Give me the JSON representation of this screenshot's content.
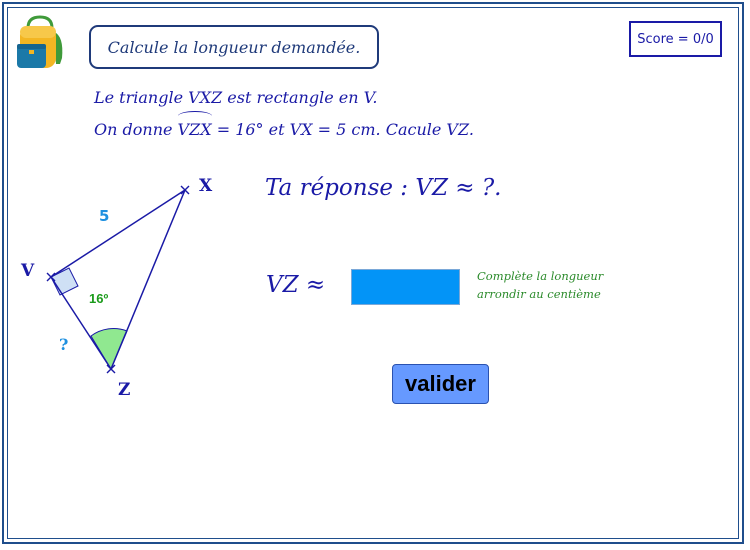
{
  "header": {
    "title": "Calcule la longueur demandée.",
    "score": "Score = 0/0"
  },
  "statement": {
    "line1": "Le triangle VXZ est rectangle en V.",
    "line2_prefix": "On donne ",
    "line2_angle": "VZX",
    "line2_suffix": " = 16° et VX = 5 cm.  Cacule VZ."
  },
  "figure": {
    "vertex_x": "X",
    "vertex_v": "V",
    "vertex_z": "Z",
    "side_vx": "5",
    "side_vz": "?",
    "angle_z": "16º"
  },
  "answer": {
    "title": "Ta réponse : VZ ≈ ?.",
    "label": "VZ ≈",
    "value": "",
    "placeholder": "",
    "hint_line1": "Complète la longueur",
    "hint_line2": "arrondir au centième"
  },
  "actions": {
    "validate_label": "valider"
  },
  "colors": {
    "frame": "#1f4e8c",
    "text_blue": "#1a1aa6",
    "input_fill": "#0394f7",
    "button_fill": "#6699ff",
    "angle_fill": "#90e890",
    "hint_green": "#2a8a2a"
  }
}
